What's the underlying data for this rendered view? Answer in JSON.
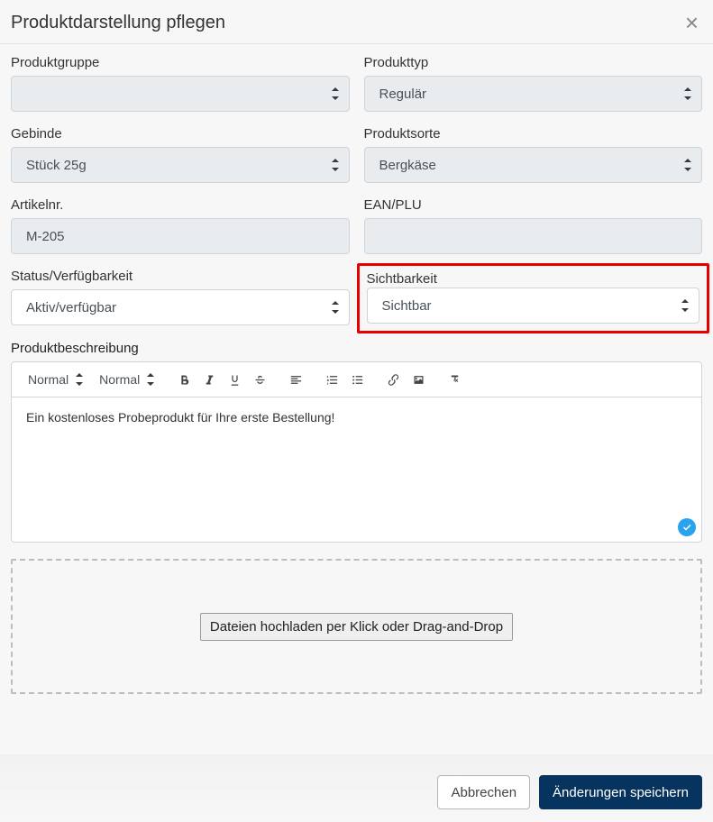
{
  "header": {
    "title": "Produktdarstellung pflegen"
  },
  "fields": {
    "produktgruppe": {
      "label": "Produktgruppe",
      "value": ""
    },
    "produkttyp": {
      "label": "Produkttyp",
      "value": "Regulär"
    },
    "gebinde": {
      "label": "Gebinde",
      "value": "Stück 25g"
    },
    "produktsorte": {
      "label": "Produktsorte",
      "value": "Bergkäse"
    },
    "artikelnr": {
      "label": "Artikelnr.",
      "value": "M-205"
    },
    "ean": {
      "label": "EAN/PLU",
      "value": ""
    },
    "status": {
      "label": "Status/Verfügbarkeit",
      "value": "Aktiv/verfügbar"
    },
    "sichtbarkeit": {
      "label": "Sichtbarkeit",
      "value": "Sichtbar"
    }
  },
  "description": {
    "label": "Produktbeschreibung",
    "toolbar": {
      "format1": "Normal",
      "format2": "Normal"
    },
    "text": "Ein kostenloses Probeprodukt für Ihre erste Bestellung!"
  },
  "dropzone": {
    "button": "Dateien hochladen per Klick oder Drag-and-Drop"
  },
  "footer": {
    "cancel": "Abbrechen",
    "save": "Änderungen speichern"
  }
}
